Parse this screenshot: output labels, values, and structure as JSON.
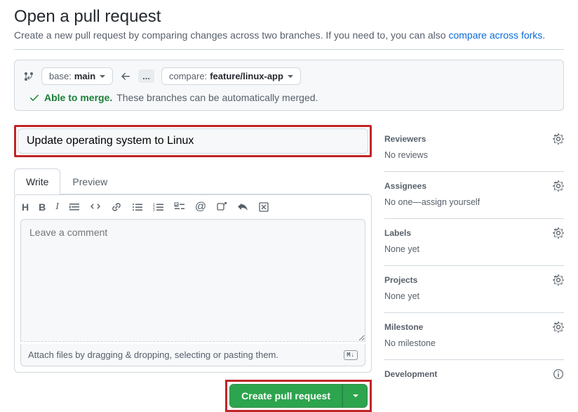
{
  "header": {
    "title": "Open a pull request",
    "subtitle_prefix": "Create a new pull request by comparing changes across two branches. If you need to, you can also ",
    "subtitle_link": "compare across forks",
    "subtitle_suffix": "."
  },
  "compare": {
    "base_label": "base: ",
    "base_branch": "main",
    "compare_label": "compare: ",
    "compare_branch": "feature/linux-app",
    "ellipsis": "...",
    "able_label": "Able to merge.",
    "able_sub": "These branches can be automatically merged."
  },
  "form": {
    "title_value": "Update operating system to Linux",
    "tabs": {
      "write": "Write",
      "preview": "Preview"
    },
    "comment_placeholder": "Leave a comment",
    "attach_hint": "Attach files by dragging & dropping, selecting or pasting them.",
    "md_badge": "M↓",
    "create_label": "Create pull request"
  },
  "sidebar": {
    "reviewers": {
      "label": "Reviewers",
      "value": "No reviews"
    },
    "assignees": {
      "label": "Assignees",
      "value_prefix": "No one—",
      "assign_self": "assign yourself"
    },
    "labels": {
      "label": "Labels",
      "value": "None yet"
    },
    "projects": {
      "label": "Projects",
      "value": "None yet"
    },
    "milestone": {
      "label": "Milestone",
      "value": "No milestone"
    },
    "development": {
      "label": "Development"
    }
  }
}
